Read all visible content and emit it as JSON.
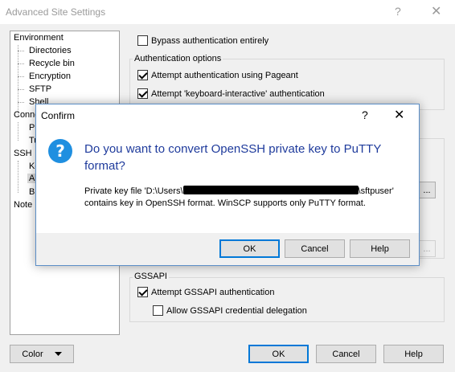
{
  "bg_window": {
    "title": "Advanced Site Settings",
    "help_glyph": "?",
    "close_glyph": "✕"
  },
  "tree": {
    "items": [
      {
        "label": "Environment"
      },
      {
        "label": "Directories"
      },
      {
        "label": "Recycle bin"
      },
      {
        "label": "Encryption"
      },
      {
        "label": "SFTP"
      },
      {
        "label": "Shell"
      },
      {
        "label": "Conne"
      },
      {
        "label": "Pr"
      },
      {
        "label": "Tu"
      },
      {
        "label": "SSH"
      },
      {
        "label": "Ke"
      },
      {
        "label": "Au"
      },
      {
        "label": "Bu"
      },
      {
        "label": "Note"
      }
    ]
  },
  "auth": {
    "bypass_label": "Bypass authentication entirely",
    "bypass_checked": false,
    "options_title": "Authentication options",
    "pageant_label": "Attempt authentication using Pageant",
    "pageant_checked": true,
    "kbi_label": "Attempt 'keyboard-interactive' authentication",
    "kbi_checked": true,
    "browse_glyph": "...",
    "gssapi_title": "GSSAPI",
    "gssapi_label": "Attempt GSSAPI authentication",
    "gssapi_checked": true,
    "delegation_label": "Allow GSSAPI credential delegation",
    "delegation_checked": false
  },
  "bottom": {
    "color_label": "Color",
    "ok_label": "OK",
    "cancel_label": "Cancel",
    "help_label": "Help"
  },
  "confirm": {
    "title": "Confirm",
    "help_glyph": "?",
    "close_glyph": "✕",
    "icon_glyph": "?",
    "heading": "Do you want to convert OpenSSH private key to PuTTY format?",
    "body_prefix": "Private key file 'D:\\Users\\",
    "body_suffix": "\\sftpuser'",
    "body_line2": "contains key in OpenSSH format. WinSCP supports only PuTTY format.",
    "ok_label": "OK",
    "cancel_label": "Cancel",
    "help_label": "Help"
  }
}
